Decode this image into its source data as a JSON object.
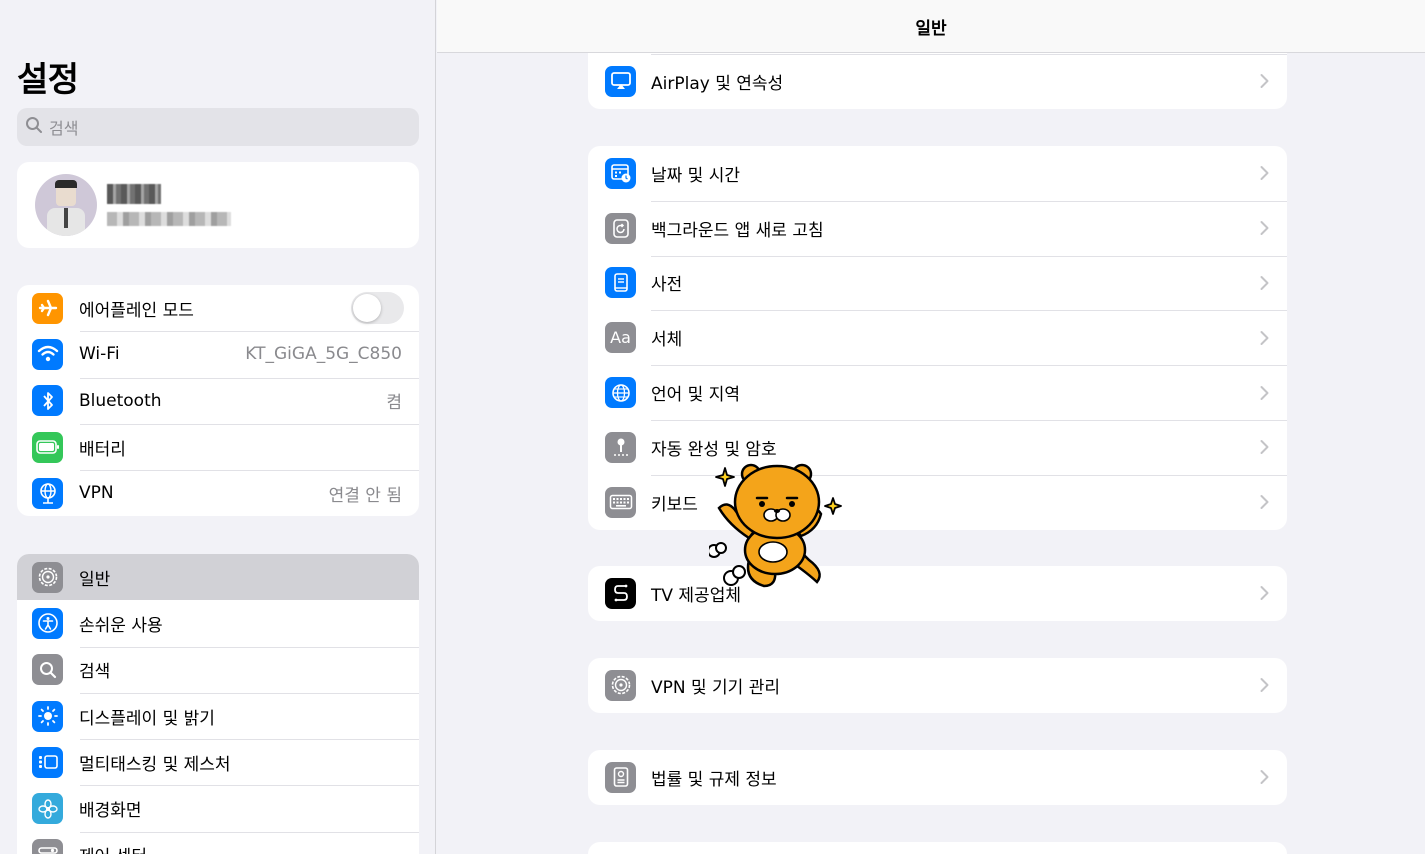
{
  "sidebar": {
    "title": "설정",
    "search_placeholder": "검색",
    "connectivity": [
      {
        "label": "에어플레인 모드",
        "icon": "airplane-icon",
        "color": "#ff9500",
        "value": "",
        "toggle": false
      },
      {
        "label": "Wi-Fi",
        "icon": "wifi-icon",
        "color": "#007aff",
        "value": "KT_GiGA_5G_C850"
      },
      {
        "label": "Bluetooth",
        "icon": "bluetooth-icon",
        "color": "#007aff",
        "value": "켬"
      },
      {
        "label": "배터리",
        "icon": "battery-icon",
        "color": "#34c759",
        "value": ""
      },
      {
        "label": "VPN",
        "icon": "globe-vpn-icon",
        "color": "#007aff",
        "value": "연결 안 됨"
      }
    ],
    "system": [
      {
        "label": "일반",
        "icon": "gear-icon",
        "color": "#8e8e93",
        "selected": true
      },
      {
        "label": "손쉬운 사용",
        "icon": "accessibility-icon",
        "color": "#007aff"
      },
      {
        "label": "검색",
        "icon": "search-icon",
        "color": "#8e8e93"
      },
      {
        "label": "디스플레이 및 밝기",
        "icon": "sun-icon",
        "color": "#007aff"
      },
      {
        "label": "멀티태스킹 및 제스처",
        "icon": "multitasking-icon",
        "color": "#007aff"
      },
      {
        "label": "배경화면",
        "icon": "flower-icon",
        "color": "#34aadc"
      },
      {
        "label": "제어 센터",
        "icon": "control-center-icon",
        "color": "#8e8e93"
      }
    ]
  },
  "main": {
    "title": "일반",
    "group1": [
      {
        "label": "AirPlay 및 연속성",
        "icon": "airplay-icon",
        "color": "#007aff"
      }
    ],
    "group2": [
      {
        "label": "날짜 및 시간",
        "icon": "calendar-clock-icon",
        "color": "#007aff"
      },
      {
        "label": "백그라운드 앱 새로 고침",
        "icon": "refresh-icon",
        "color": "#8e8e93"
      },
      {
        "label": "사전",
        "icon": "book-icon",
        "color": "#007aff"
      },
      {
        "label": "서체",
        "icon": "font-icon",
        "color": "#8e8e93"
      },
      {
        "label": "언어 및 지역",
        "icon": "globe-icon",
        "color": "#007aff"
      },
      {
        "label": "자동 완성 및 암호",
        "icon": "key-icon",
        "color": "#8e8e93"
      },
      {
        "label": "키보드",
        "icon": "keyboard-icon",
        "color": "#8e8e93"
      }
    ],
    "group3": [
      {
        "label": "TV 제공업체",
        "icon": "tv-provider-icon",
        "color": "#000000"
      }
    ],
    "group4": [
      {
        "label": "VPN 및 기기 관리",
        "icon": "gear-icon",
        "color": "#8e8e93"
      }
    ],
    "group5": [
      {
        "label": "법률 및 규제 정보",
        "icon": "legal-icon",
        "color": "#8e8e93"
      }
    ],
    "font_icon_text": "Aa"
  }
}
